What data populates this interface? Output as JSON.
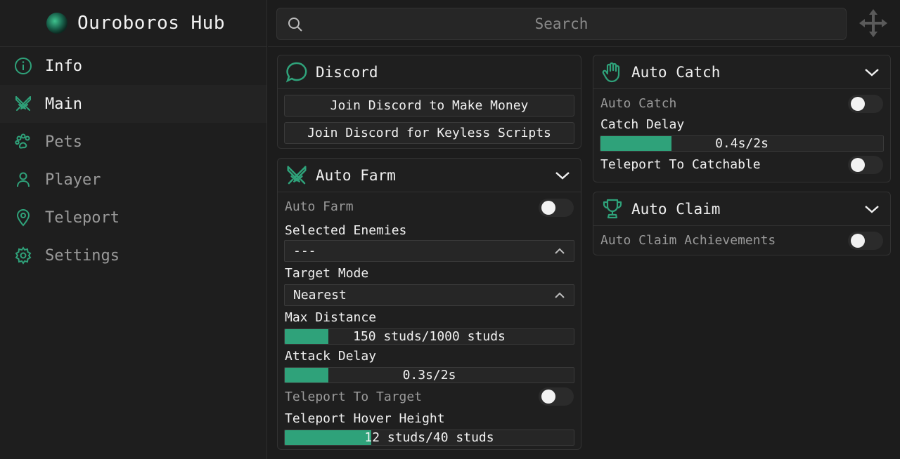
{
  "app": {
    "title": "Ouroboros Hub",
    "accent_color": "#2fa27a"
  },
  "sidebar": {
    "items": [
      {
        "label": "Info",
        "icon": "info-icon"
      },
      {
        "label": "Main",
        "icon": "swords-icon",
        "active": true
      },
      {
        "label": "Pets",
        "icon": "paw-icon"
      },
      {
        "label": "Player",
        "icon": "user-icon"
      },
      {
        "label": "Teleport",
        "icon": "map-pin-icon"
      },
      {
        "label": "Settings",
        "icon": "gear-icon"
      }
    ]
  },
  "search": {
    "placeholder": "Search"
  },
  "discord": {
    "title": "Discord",
    "buttons": [
      "Join Discord to Make Money",
      "Join Discord for Keyless Scripts"
    ]
  },
  "auto_farm": {
    "title": "Auto Farm",
    "auto_farm_label": "Auto Farm",
    "auto_farm_on": false,
    "selected_enemies_label": "Selected Enemies",
    "selected_enemies_value": "---",
    "target_mode_label": "Target Mode",
    "target_mode_value": "Nearest",
    "max_distance_label": "Max Distance",
    "max_distance_text": "150 studs/1000 studs",
    "max_distance_fraction": 0.15,
    "attack_delay_label": "Attack Delay",
    "attack_delay_text": "0.3s/2s",
    "attack_delay_fraction": 0.15,
    "teleport_to_target_label": "Teleport To Target",
    "teleport_to_target_on": false,
    "hover_height_label": "Teleport Hover Height",
    "hover_height_text": "12 studs/40 studs",
    "hover_height_fraction": 0.3
  },
  "auto_catch": {
    "title": "Auto Catch",
    "auto_catch_label": "Auto Catch",
    "auto_catch_on": false,
    "catch_delay_label": "Catch Delay",
    "catch_delay_text": "0.4s/2s",
    "catch_delay_fraction": 0.25,
    "teleport_label": "Teleport To Catchable",
    "teleport_on": false
  },
  "auto_claim": {
    "title": "Auto Claim",
    "achievements_label": "Auto Claim Achievements",
    "achievements_on": false
  }
}
